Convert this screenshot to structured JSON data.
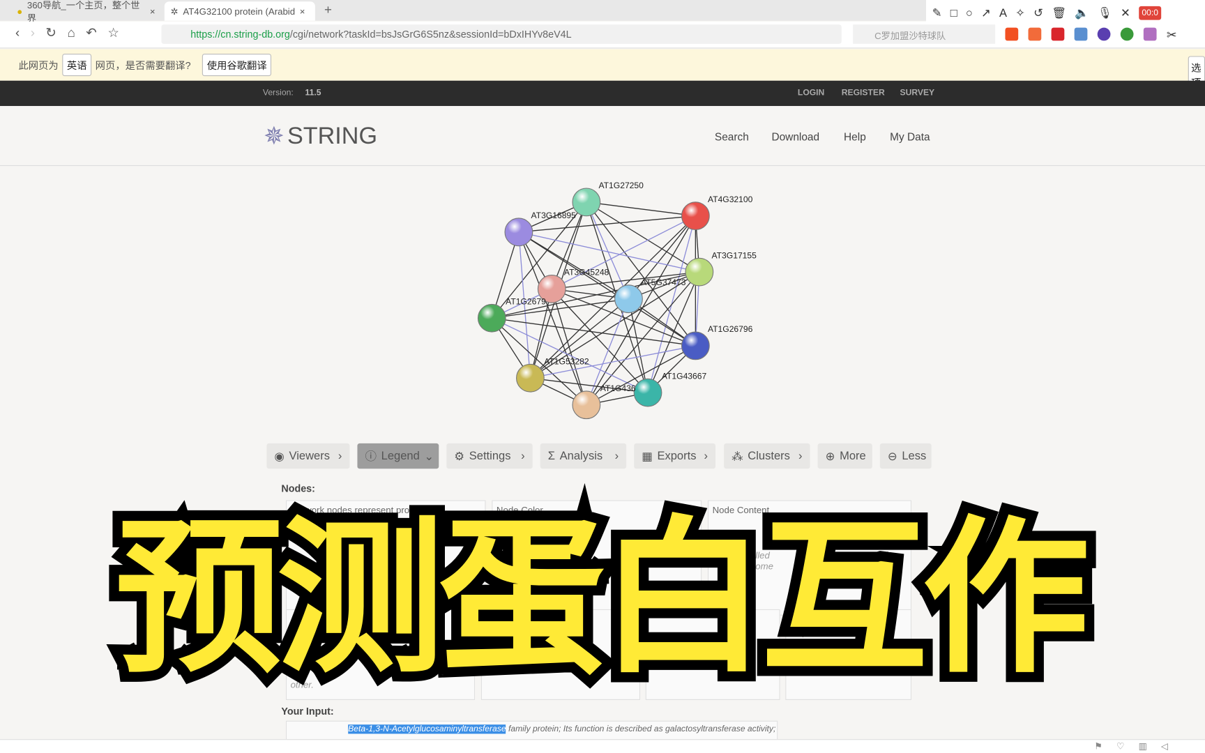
{
  "browser": {
    "tabs": [
      {
        "label": "360导航_一个主页，整个世界"
      },
      {
        "label": "AT4G32100 protein (Arabid"
      }
    ],
    "new_tab": "+",
    "url_host": "https://cn.string-db.org",
    "url_path": "/cgi/network?taskId=bsJsGrG6S5nz&sessionId=bDxIHYv8eV4L",
    "search_placeholder": "C罗加盟沙特球队",
    "record_time": "00:0"
  },
  "translate_bar": {
    "prefix": "此网页为",
    "language": "英语",
    "question": "网页，是否需要翻译?",
    "translate_button": "使用谷歌翻译",
    "options": "选项"
  },
  "topbar": {
    "version_label": "Version:",
    "version": "11.5",
    "links": [
      "LOGIN",
      "REGISTER",
      "SURVEY"
    ]
  },
  "header": {
    "logo": "STRING",
    "nav": [
      "Search",
      "Download",
      "Help",
      "My Data"
    ]
  },
  "network": {
    "nodes": [
      {
        "id": "AT1G27250",
        "color": "#7fd4b0"
      },
      {
        "id": "AT4G32100",
        "color": "#e8504a"
      },
      {
        "id": "AT3G16895",
        "color": "#9b8be0"
      },
      {
        "id": "AT3G17155",
        "color": "#b8d97a"
      },
      {
        "id": "AT3G45248",
        "color": "#e6a09a"
      },
      {
        "id": "AT5G37473",
        "color": "#8ec9ea"
      },
      {
        "id": "AT1G2679",
        "color": "#4caa5a"
      },
      {
        "id": "AT1G26796",
        "color": "#4a5cc4"
      },
      {
        "id": "AT1G53282",
        "color": "#c9b955"
      },
      {
        "id": "AT1G43667",
        "color": "#3bb5a8"
      },
      {
        "id": "AT1G436",
        "color": "#e8c09a"
      }
    ]
  },
  "toolbar": {
    "buttons": [
      {
        "label": "Viewers",
        "icon": "eye-icon"
      },
      {
        "label": "Legend",
        "icon": "info-icon"
      },
      {
        "label": "Settings",
        "icon": "gear-icon"
      },
      {
        "label": "Analysis",
        "icon": "sigma-icon"
      },
      {
        "label": "Exports",
        "icon": "table-icon"
      },
      {
        "label": "Clusters",
        "icon": "clusters-icon"
      },
      {
        "label": "More",
        "icon": "plus-icon"
      },
      {
        "label": "Less",
        "icon": "minus-icon"
      }
    ]
  },
  "legend": {
    "nodes_heading": "Nodes:",
    "boxes": [
      "Network nodes represent proteins",
      "Node Color",
      "Node Content"
    ],
    "fragments": [
      "other.",
      "filled",
      "some"
    ],
    "input_heading": "Your Input:",
    "input_highlight": "Beta-1,3-N-Acetylglucosaminyltransferase",
    "input_rest": " family protein; Its function is described as galactosyltransferase activity;"
  },
  "overlay": {
    "title": "预测蛋白互作"
  }
}
